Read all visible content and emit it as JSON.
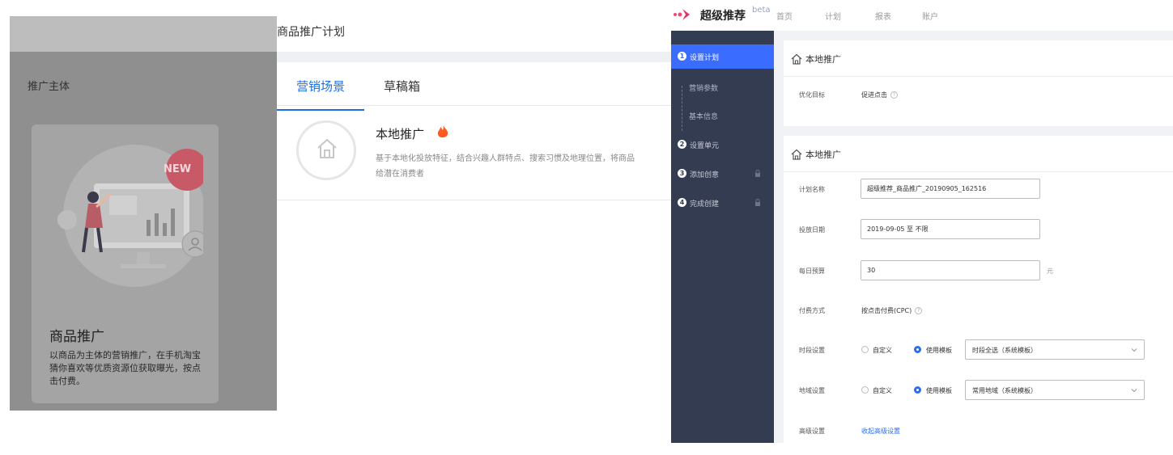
{
  "left": {
    "sub_title": "推广主体",
    "card": {
      "badge": "NEW",
      "title": "商品推广",
      "desc": "以商品为主体的营销推广，在手机淘宝猜你喜欢等优质资源位获取曝光，按点击付费。"
    }
  },
  "middle": {
    "title": "商品推广计划",
    "tabs": [
      {
        "label": "营销场景",
        "active": true
      },
      {
        "label": "草稿箱",
        "active": false
      }
    ],
    "local": {
      "title": "本地推广",
      "desc_line1": "基于本地化投放特征，结合兴趣人群特点、搜索习惯及地理位置，将商品",
      "desc_line2": "给潜在消费者"
    }
  },
  "topnav": {
    "brand": "超级推荐",
    "beta": "beta",
    "links": [
      "首页",
      "计划",
      "报表",
      "账户"
    ]
  },
  "sidebar": {
    "steps": [
      {
        "num": "1",
        "label": "设置计划",
        "active": true
      },
      {
        "num": "2",
        "label": "设置单元",
        "active": false
      },
      {
        "num": "3",
        "label": "添加创意",
        "active": false,
        "locked": true
      },
      {
        "num": "4",
        "label": "完成创建",
        "active": false,
        "locked": true
      }
    ],
    "sub_items": [
      "营销参数",
      "基本信息"
    ]
  },
  "form": {
    "section1": {
      "title": "本地推广",
      "goal_label": "优化目标",
      "goal_value": "促进点击"
    },
    "section2": {
      "title": "本地推广",
      "plan_name_label": "计划名称",
      "plan_name_value": "超级推荐_商品推广_20190905_162516",
      "date_label": "投放日期",
      "date_value": "2019-09-05 至 不限",
      "budget_label": "每日预算",
      "budget_value": "30",
      "budget_unit": "元",
      "pay_label": "付费方式",
      "pay_value": "按点击付费(CPC)",
      "time_label": "时段设置",
      "time_custom": "自定义",
      "time_template": "使用模板",
      "time_select": "时段全选（系统模板）",
      "region_label": "地域设置",
      "region_custom": "自定义",
      "region_template": "使用模板",
      "region_select": "常用地域（系统模板）",
      "advanced_label": "高级设置",
      "advanced_link": "收起高级设置"
    }
  },
  "colors": {
    "accent": "#3a6cff",
    "sidebar_bg": "#343c52",
    "tab_active": "#1d6fe0",
    "fire": "#ff5a1f"
  }
}
